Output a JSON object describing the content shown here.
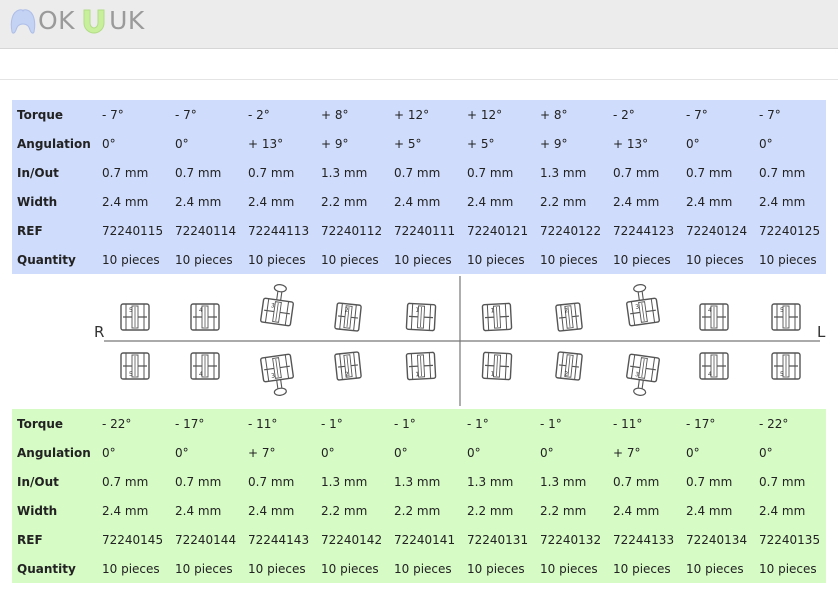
{
  "header": {
    "logo_left": "OK",
    "logo_right": "UK"
  },
  "upper_table": {
    "rows": [
      {
        "label": "Torque",
        "cells": [
          "- 7°",
          "- 7°",
          "- 2°",
          "+ 8°",
          "+ 12°",
          "+ 12°",
          "+ 8°",
          "- 2°",
          "- 7°",
          "- 7°"
        ]
      },
      {
        "label": "Angulation",
        "cells": [
          "0°",
          "0°",
          "+ 13°",
          "+ 9°",
          "+ 5°",
          "+ 5°",
          "+ 9°",
          "+ 13°",
          "0°",
          "0°"
        ]
      },
      {
        "label": "In/Out",
        "cells": [
          "0.7 mm",
          "0.7 mm",
          "0.7 mm",
          "1.3 mm",
          "0.7 mm",
          "0.7 mm",
          "1.3 mm",
          "0.7 mm",
          "0.7 mm",
          "0.7 mm"
        ]
      },
      {
        "label": "Width",
        "cells": [
          "2.4 mm",
          "2.4 mm",
          "2.4 mm",
          "2.2 mm",
          "2.4 mm",
          "2.4 mm",
          "2.2 mm",
          "2.4 mm",
          "2.4 mm",
          "2.4 mm"
        ]
      },
      {
        "label": "REF",
        "cells": [
          "72240115",
          "72240114",
          "72244113",
          "72240112",
          "72240111",
          "72240121",
          "72240122",
          "72244123",
          "72240124",
          "72240125"
        ]
      },
      {
        "label": "Quantity",
        "cells": [
          "10 pieces",
          "10 pieces",
          "10 pieces",
          "10 pieces",
          "10 pieces",
          "10 pieces",
          "10 pieces",
          "10 pieces",
          "10 pieces",
          "10 pieces"
        ]
      }
    ]
  },
  "diagram": {
    "side_left": "R",
    "side_right": "L",
    "upper_numbers": [
      "5",
      "4",
      "3",
      "2",
      "1",
      "1",
      "2",
      "3",
      "4",
      "5"
    ],
    "lower_numbers": [
      "5",
      "4",
      "3",
      "2",
      "1",
      "1",
      "2",
      "3",
      "4",
      "5"
    ]
  },
  "lower_table": {
    "rows": [
      {
        "label": "Torque",
        "cells": [
          "- 22°",
          "- 17°",
          "- 11°",
          "- 1°",
          "- 1°",
          "- 1°",
          "- 1°",
          "- 11°",
          "- 17°",
          "- 22°"
        ]
      },
      {
        "label": "Angulation",
        "cells": [
          "0°",
          "0°",
          "+ 7°",
          "0°",
          "0°",
          "0°",
          "0°",
          "+ 7°",
          "0°",
          "0°"
        ]
      },
      {
        "label": "In/Out",
        "cells": [
          "0.7 mm",
          "0.7 mm",
          "0.7 mm",
          "1.3 mm",
          "1.3 mm",
          "1.3 mm",
          "1.3 mm",
          "0.7 mm",
          "0.7 mm",
          "0.7 mm"
        ]
      },
      {
        "label": "Width",
        "cells": [
          "2.4 mm",
          "2.4 mm",
          "2.4 mm",
          "2.2 mm",
          "2.2 mm",
          "2.2 mm",
          "2.2 mm",
          "2.4 mm",
          "2.4 mm",
          "2.4 mm"
        ]
      },
      {
        "label": "REF",
        "cells": [
          "72240145",
          "72240144",
          "72244143",
          "72240142",
          "72240141",
          "72240131",
          "72240132",
          "72244133",
          "72240134",
          "72240135"
        ]
      },
      {
        "label": "Quantity",
        "cells": [
          "10 pieces",
          "10 pieces",
          "10 pieces",
          "10 pieces",
          "10 pieces",
          "10 pieces",
          "10 pieces",
          "10 pieces",
          "10 pieces",
          "10 pieces"
        ]
      }
    ]
  }
}
